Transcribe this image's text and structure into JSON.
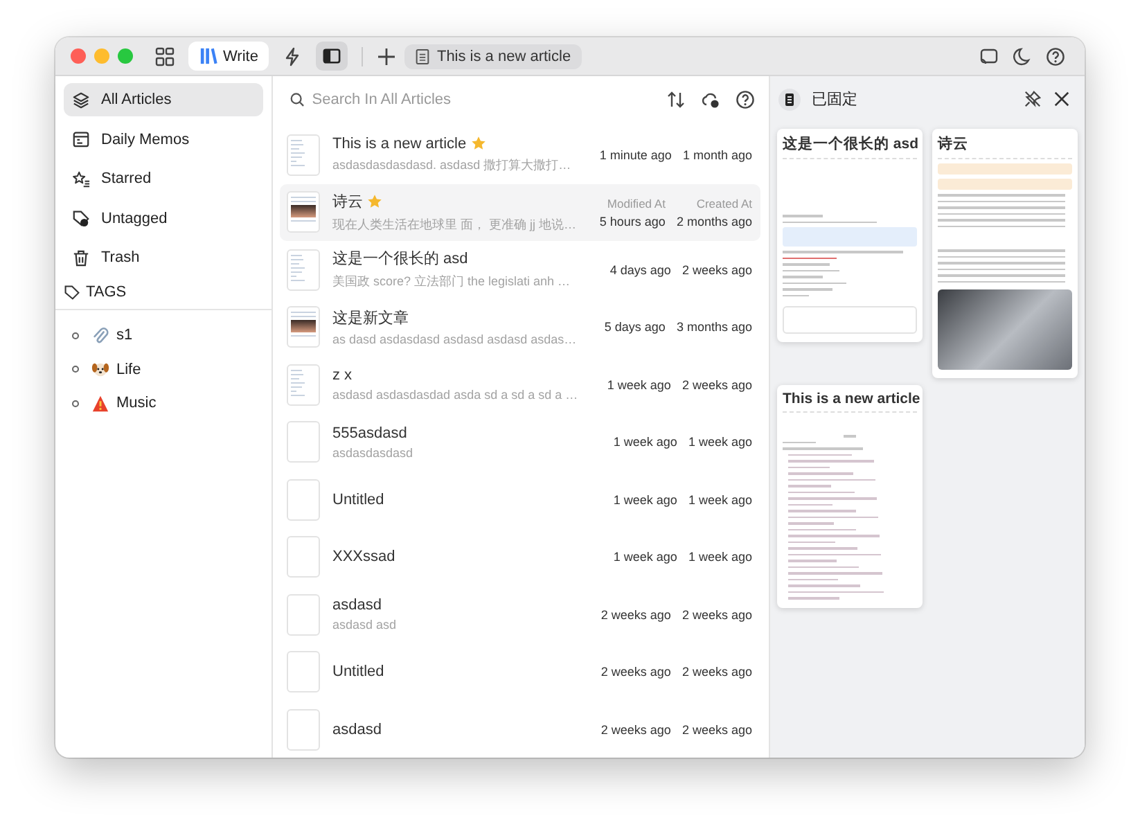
{
  "toolbar": {
    "tabs": [
      {
        "label": "Write",
        "selected": true
      }
    ],
    "sidebar_toggle": {
      "on": true
    },
    "document_tab": {
      "label": "This is a new article"
    }
  },
  "sidebar": {
    "items": [
      {
        "label": "All Articles",
        "kind": "layers",
        "selected": true
      },
      {
        "label": "Daily Memos",
        "kind": "calendar",
        "selected": false
      },
      {
        "label": "Starred",
        "kind": "star",
        "selected": false
      },
      {
        "label": "Untagged",
        "kind": "tag",
        "selected": false
      },
      {
        "label": "Trash",
        "kind": "trash",
        "selected": false
      }
    ],
    "tags_heading": "TAGS",
    "tags": [
      {
        "label": "s1",
        "kind": "paperclip"
      },
      {
        "label": "Life",
        "kind": "dog"
      },
      {
        "label": "Music",
        "kind": "warning"
      }
    ]
  },
  "list": {
    "search": {
      "placeholder": "Search In All Articles"
    },
    "modified_label": "Modified At",
    "created_label": "Created At",
    "rows": [
      {
        "title": "This is a new article",
        "starred": true,
        "preview": "asdasdasdasdasd. asdasd 撒打算大撒打…",
        "modified": "1 minute ago",
        "created": "1 month ago",
        "kind": "text",
        "selected": false
      },
      {
        "title": "诗云",
        "starred": true,
        "preview": "现在人类生活在地球里 面， 更准确 jj 地说…",
        "modified": "5 hours ago",
        "created": "2 months ago",
        "kind": "image",
        "selected": true
      },
      {
        "title": "这是一个很长的 asd",
        "starred": false,
        "preview": "美国政 score? 立法部门 the legislati anh …",
        "modified": "4 days ago",
        "created": "2 weeks ago",
        "kind": "text",
        "selected": false
      },
      {
        "title": "这是新文章",
        "starred": false,
        "preview": "as dasd asdasdasd asdasd asdasd asdas…",
        "modified": "5 days ago",
        "created": "3 months ago",
        "kind": "image",
        "selected": false
      },
      {
        "title": "z x",
        "starred": false,
        "preview": "asdasd asdasdasdad asda sd a sd a sd a …",
        "modified": "1 week ago",
        "created": "2 weeks ago",
        "kind": "text",
        "selected": false
      },
      {
        "title": "555asdasd",
        "starred": false,
        "preview": "asdasdasdasd",
        "modified": "1 week ago",
        "created": "1 week ago",
        "kind": "blank",
        "selected": false
      },
      {
        "title": "Untitled",
        "starred": false,
        "modified": "1 week ago",
        "created": "1 week ago",
        "kind": "blank",
        "selected": false
      },
      {
        "title": "XXXssad",
        "starred": false,
        "modified": "1 week ago",
        "created": "1 week ago",
        "kind": "blank",
        "selected": false
      },
      {
        "title": "asdasd",
        "starred": false,
        "preview": "asdasd asd",
        "modified": "2 weeks ago",
        "created": "2 weeks ago",
        "kind": "blank",
        "selected": false
      },
      {
        "title": "Untitled",
        "starred": false,
        "modified": "2 weeks ago",
        "created": "2 weeks ago",
        "kind": "blank",
        "selected": false
      },
      {
        "title": "asdasd",
        "starred": false,
        "modified": "2 weeks ago",
        "created": "2 weeks ago",
        "kind": "blank",
        "selected": false
      }
    ]
  },
  "pinned": {
    "title": "已固定",
    "cards": [
      {
        "title": "这是一个很长的 asd",
        "kind": "text"
      },
      {
        "title": "诗云",
        "kind": "image"
      },
      {
        "title": "This is a new article",
        "kind": "list"
      }
    ]
  }
}
